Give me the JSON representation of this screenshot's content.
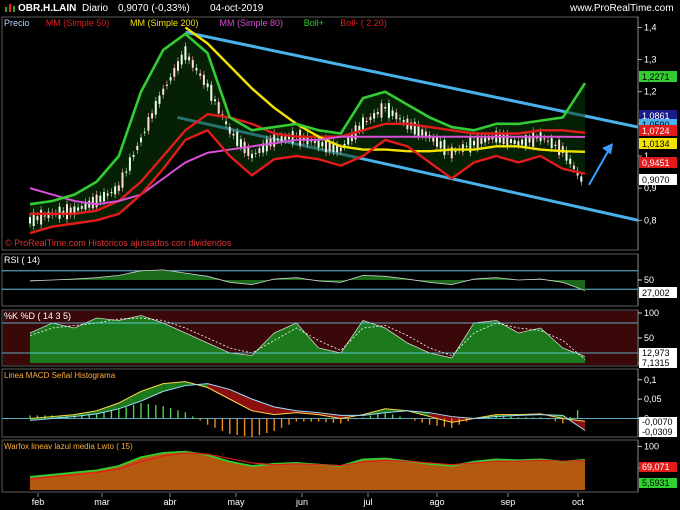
{
  "header": {
    "symbol": "OBR.H.LAIN",
    "period": "Diario",
    "quote": "0,9070 (-0,33%)",
    "date": "04-oct-2019",
    "site": "www.ProRealTime.com"
  },
  "colors": {
    "price_up": "#1a9e1a",
    "price_down": "#e02020",
    "sma50": "#e21b1b",
    "sma200": "#f2e400",
    "sma80": "#d84fd8",
    "bollinger": "#33cc33",
    "channel": "#49b2ea",
    "arrow": "#3aa0ff"
  },
  "main": {
    "legend": [
      {
        "label": "Precio",
        "color": "#b0d8ff"
      },
      {
        "label": "MM (Simple 50)",
        "color": "#e21b1b"
      },
      {
        "label": "MM (Simple 200)",
        "color": "#f2e400"
      },
      {
        "label": "MM (Simple 80)",
        "color": "#d84fd8"
      },
      {
        "label": "Boll+",
        "color": "#33cc33"
      },
      {
        "label": "Boll- ( 2 20)",
        "color": "#e21b1b"
      }
    ],
    "yticks": [
      "1,4",
      "1,3",
      "1,2",
      "1,1",
      "1",
      "0,9",
      "0,8"
    ],
    "price_tags": [
      {
        "text": "1,2271",
        "color": "#33cc33"
      },
      {
        "text": "1,0861",
        "color": "#1b1b8a"
      },
      {
        "text": "1,0590",
        "color": "#49b2ea"
      },
      {
        "text": "1,0724",
        "color": "#e21b1b"
      },
      {
        "text": "1,0134",
        "color": "#f2e400"
      },
      {
        "text": "0,9451",
        "color": "#e21b1b"
      },
      {
        "text": "0,9070",
        "color": "#ffffff"
      }
    ],
    "watermark": "© ProRealTime.com  Históricos ajustados con dividendos"
  },
  "rsi": {
    "legend": "RSI ( 14)",
    "yticks": [
      "50"
    ],
    "value_tag": "27,002"
  },
  "stoch": {
    "legend": "%K %D ( 14 3 5)",
    "yticks": [
      "100",
      "50",
      "0"
    ],
    "value_tags": [
      "12,973",
      "7,1315"
    ]
  },
  "macd": {
    "legend": "Linea MACD  Señal  Histograma",
    "yticks": [
      "0,1",
      "0,05",
      "0"
    ],
    "value_tags": [
      "-0,0070",
      "-0,0309"
    ]
  },
  "warfox": {
    "legend": "Warfox  lineav  lazul  media  Lwto ( 15)",
    "yticks": [
      "100",
      "50"
    ],
    "value_tags": [
      "69,071",
      "5,5931"
    ]
  },
  "x_months": [
    "feb",
    "mar",
    "abr",
    "may",
    "jun",
    "jul",
    "ago",
    "sep",
    "oct"
  ],
  "chart_data": [
    {
      "type": "line",
      "title": "OBR.H.LAIN Diario",
      "xlabel": "",
      "ylabel": "",
      "ylim": [
        0.72,
        1.42
      ],
      "x_months": [
        "feb",
        "mar",
        "abr",
        "may",
        "jun",
        "jul",
        "ago",
        "sep",
        "oct"
      ],
      "series": [
        {
          "name": "Precio",
          "values": [
            0.8,
            0.82,
            0.83,
            0.86,
            0.9,
            1.05,
            1.2,
            1.32,
            1.22,
            1.08,
            1.0,
            1.05,
            1.06,
            1.04,
            1.02,
            1.1,
            1.15,
            1.1,
            1.06,
            1.01,
            1.04,
            1.06,
            1.04,
            1.06,
            1.02,
            0.91
          ]
        },
        {
          "name": "MM (Simple 50)",
          "values": [
            0.82,
            0.82,
            0.82,
            0.83,
            0.86,
            0.92,
            1.0,
            1.08,
            1.13,
            1.12,
            1.1,
            1.07,
            1.06,
            1.06,
            1.06,
            1.08,
            1.1,
            1.1,
            1.09,
            1.08,
            1.07,
            1.07,
            1.07,
            1.08,
            1.08,
            1.072
          ]
        },
        {
          "name": "MM (Simple 200)",
          "values": [
            null,
            null,
            null,
            null,
            null,
            null,
            null,
            1.4,
            1.35,
            1.28,
            1.21,
            1.15,
            1.1,
            1.06,
            1.03,
            1.02,
            1.02,
            1.015,
            1.015,
            1.02,
            1.02,
            1.03,
            1.03,
            1.02,
            1.015,
            1.013
          ]
        },
        {
          "name": "MM (Simple 80)",
          "values": [
            0.9,
            0.88,
            0.86,
            0.85,
            0.86,
            0.88,
            0.93,
            0.98,
            1.01,
            1.02,
            1.03,
            1.04,
            1.05,
            1.05,
            1.06,
            1.06,
            1.06,
            1.06,
            1.06,
            1.06,
            1.06,
            1.06,
            1.06,
            1.06,
            1.06,
            1.059
          ]
        },
        {
          "name": "Boll+",
          "values": [
            0.85,
            0.86,
            0.88,
            0.92,
            1.0,
            1.2,
            1.33,
            1.38,
            1.32,
            1.12,
            1.08,
            1.09,
            1.1,
            1.08,
            1.07,
            1.18,
            1.2,
            1.16,
            1.12,
            1.09,
            1.08,
            1.1,
            1.1,
            1.11,
            1.12,
            1.227
          ]
        },
        {
          "name": "Boll- ( 2 20)",
          "values": [
            0.76,
            0.78,
            0.79,
            0.8,
            0.82,
            0.88,
            0.96,
            1.05,
            1.08,
            1.0,
            0.94,
            0.99,
            1.0,
            0.99,
            0.97,
            1.0,
            1.05,
            1.03,
            0.98,
            0.93,
            0.98,
            1.0,
            0.98,
            1.0,
            0.96,
            0.945
          ]
        }
      ]
    },
    {
      "type": "line",
      "title": "RSI ( 14)",
      "ylim": [
        0,
        100
      ],
      "series": [
        {
          "name": "RSI ( 14)",
          "values": [
            48,
            50,
            52,
            55,
            60,
            70,
            72,
            65,
            58,
            45,
            40,
            52,
            55,
            48,
            45,
            60,
            58,
            52,
            45,
            40,
            52,
            55,
            50,
            52,
            45,
            27
          ]
        }
      ]
    },
    {
      "type": "line",
      "title": "%K %D ( 14 3 5)",
      "ylim": [
        0,
        100
      ],
      "series": [
        {
          "name": "%K",
          "values": [
            60,
            80,
            70,
            90,
            85,
            95,
            80,
            60,
            40,
            20,
            15,
            60,
            80,
            30,
            20,
            85,
            70,
            40,
            20,
            10,
            80,
            85,
            60,
            70,
            30,
            13
          ]
        },
        {
          "name": "%D",
          "values": [
            55,
            70,
            75,
            80,
            88,
            90,
            85,
            70,
            50,
            30,
            20,
            45,
            70,
            45,
            25,
            70,
            75,
            55,
            30,
            15,
            60,
            80,
            70,
            65,
            45,
            7
          ]
        }
      ]
    },
    {
      "type": "bar",
      "title": "Linea MACD  Señal  Histograma",
      "ylim": [
        -0.04,
        0.12
      ],
      "series": [
        {
          "name": "Linea MACD",
          "values": [
            0.0,
            0.005,
            0.01,
            0.02,
            0.04,
            0.07,
            0.09,
            0.095,
            0.08,
            0.05,
            0.02,
            0.01,
            0.015,
            0.01,
            0.0,
            0.01,
            0.025,
            0.02,
            0.005,
            -0.01,
            0.0,
            0.01,
            0.01,
            0.012,
            0.0,
            -0.007
          ]
        },
        {
          "name": "Señal",
          "values": [
            -0.005,
            0.0,
            0.005,
            0.012,
            0.025,
            0.045,
            0.07,
            0.085,
            0.09,
            0.075,
            0.05,
            0.03,
            0.02,
            0.015,
            0.008,
            0.008,
            0.015,
            0.02,
            0.015,
            0.005,
            0.0,
            0.005,
            0.008,
            0.01,
            0.008,
            -0.031
          ]
        }
      ]
    },
    {
      "type": "area",
      "title": "Warfox  lineav  lazul  media  Lwto ( 15)",
      "ylim": [
        0,
        110
      ],
      "series": [
        {
          "name": "Warfox",
          "values": [
            30,
            35,
            40,
            45,
            55,
            75,
            85,
            88,
            80,
            65,
            55,
            60,
            62,
            58,
            55,
            70,
            72,
            66,
            60,
            55,
            65,
            70,
            68,
            70,
            65,
            69
          ]
        },
        {
          "name": "media",
          "values": [
            25,
            30,
            35,
            40,
            48,
            65,
            78,
            85,
            82,
            72,
            62,
            58,
            60,
            58,
            56,
            64,
            68,
            66,
            62,
            58,
            62,
            66,
            66,
            68,
            66,
            67
          ]
        }
      ]
    }
  ]
}
